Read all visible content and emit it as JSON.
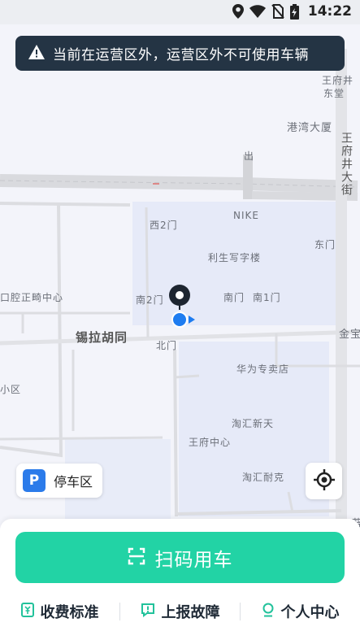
{
  "status_bar": {
    "time": "14:22",
    "icons": [
      "location-icon",
      "wifi-icon",
      "no-sim-icon",
      "battery-charging-icon"
    ]
  },
  "banner": {
    "icon": "warning-icon",
    "text": "当前在运营区外，运营区外不可使用车辆"
  },
  "map": {
    "labels": {
      "wangfujing_top": "王府井",
      "wangfujing_top2": "东堂",
      "gangwan": "港湾大厦",
      "chu": "出",
      "wangfujing_street": "王府井大街",
      "nike": "NIKE",
      "xi2men": "西2门",
      "lisheng": "利生写字楼",
      "dongmen": "东门",
      "kouqiang": "口腔正畸中心",
      "nan2men": "南2门",
      "nanmen": "南门",
      "nan1men": "南1门",
      "xila": "锡拉胡同",
      "beimen": "北门",
      "jinbao": "金宝",
      "huawei": "华为专卖店",
      "xiaoqu": "小区",
      "taohui_xintian": "淘汇新天",
      "wangfujing_center": "王府中心",
      "taohui_naike": "淘汇耐克",
      "edge_bottom": "苔"
    }
  },
  "parking": {
    "icon_letter": "P",
    "label": "停车区"
  },
  "locate_button": {
    "icon": "crosshair-icon"
  },
  "scan_button": {
    "icon": "scan-icon",
    "label": "扫码用车"
  },
  "bottom_nav": [
    {
      "icon": "fee-icon",
      "label": "收费标准"
    },
    {
      "icon": "report-icon",
      "label": "上报故障"
    },
    {
      "icon": "user-icon",
      "label": "个人中心"
    }
  ],
  "colors": {
    "accent": "#22d3a5",
    "banner_bg": "#243444",
    "parking_blue": "#2b7bea",
    "location_blue": "#1e7cf0"
  }
}
